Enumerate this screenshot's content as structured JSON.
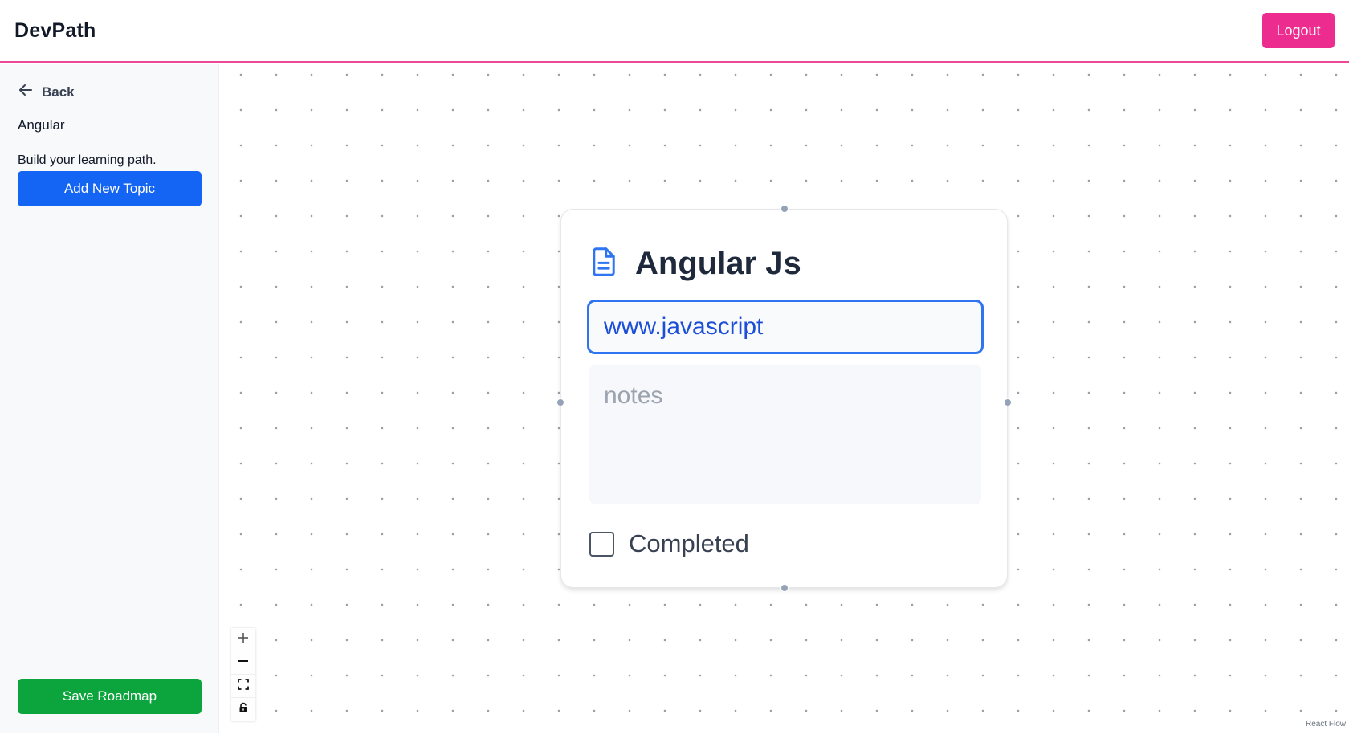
{
  "header": {
    "brand": "DevPath",
    "logout_label": "Logout"
  },
  "sidebar": {
    "back_label": "Back",
    "roadmap_name": "Angular",
    "subtitle": "Build your learning path.",
    "add_topic_label": "Add New Topic",
    "save_label": "Save Roadmap"
  },
  "node": {
    "icon": "document-icon",
    "title": "Angular Js",
    "url_value": "www.javascript",
    "notes_placeholder": "notes",
    "notes_value": "",
    "completed_label": "Completed",
    "completed": false
  },
  "controls": {
    "zoom_in_icon": "plus-icon",
    "zoom_out_icon": "minus-icon",
    "fit_view_icon": "fit-view-icon",
    "lock_icon": "lock-icon"
  },
  "canvas": {
    "attribution": "React Flow"
  },
  "colors": {
    "brand_accent": "#ec4899",
    "logout_bg": "#ec2d8f",
    "add_topic_bg": "#1565f5",
    "save_bg": "#0ca43c",
    "input_focus": "#2f74f0"
  }
}
